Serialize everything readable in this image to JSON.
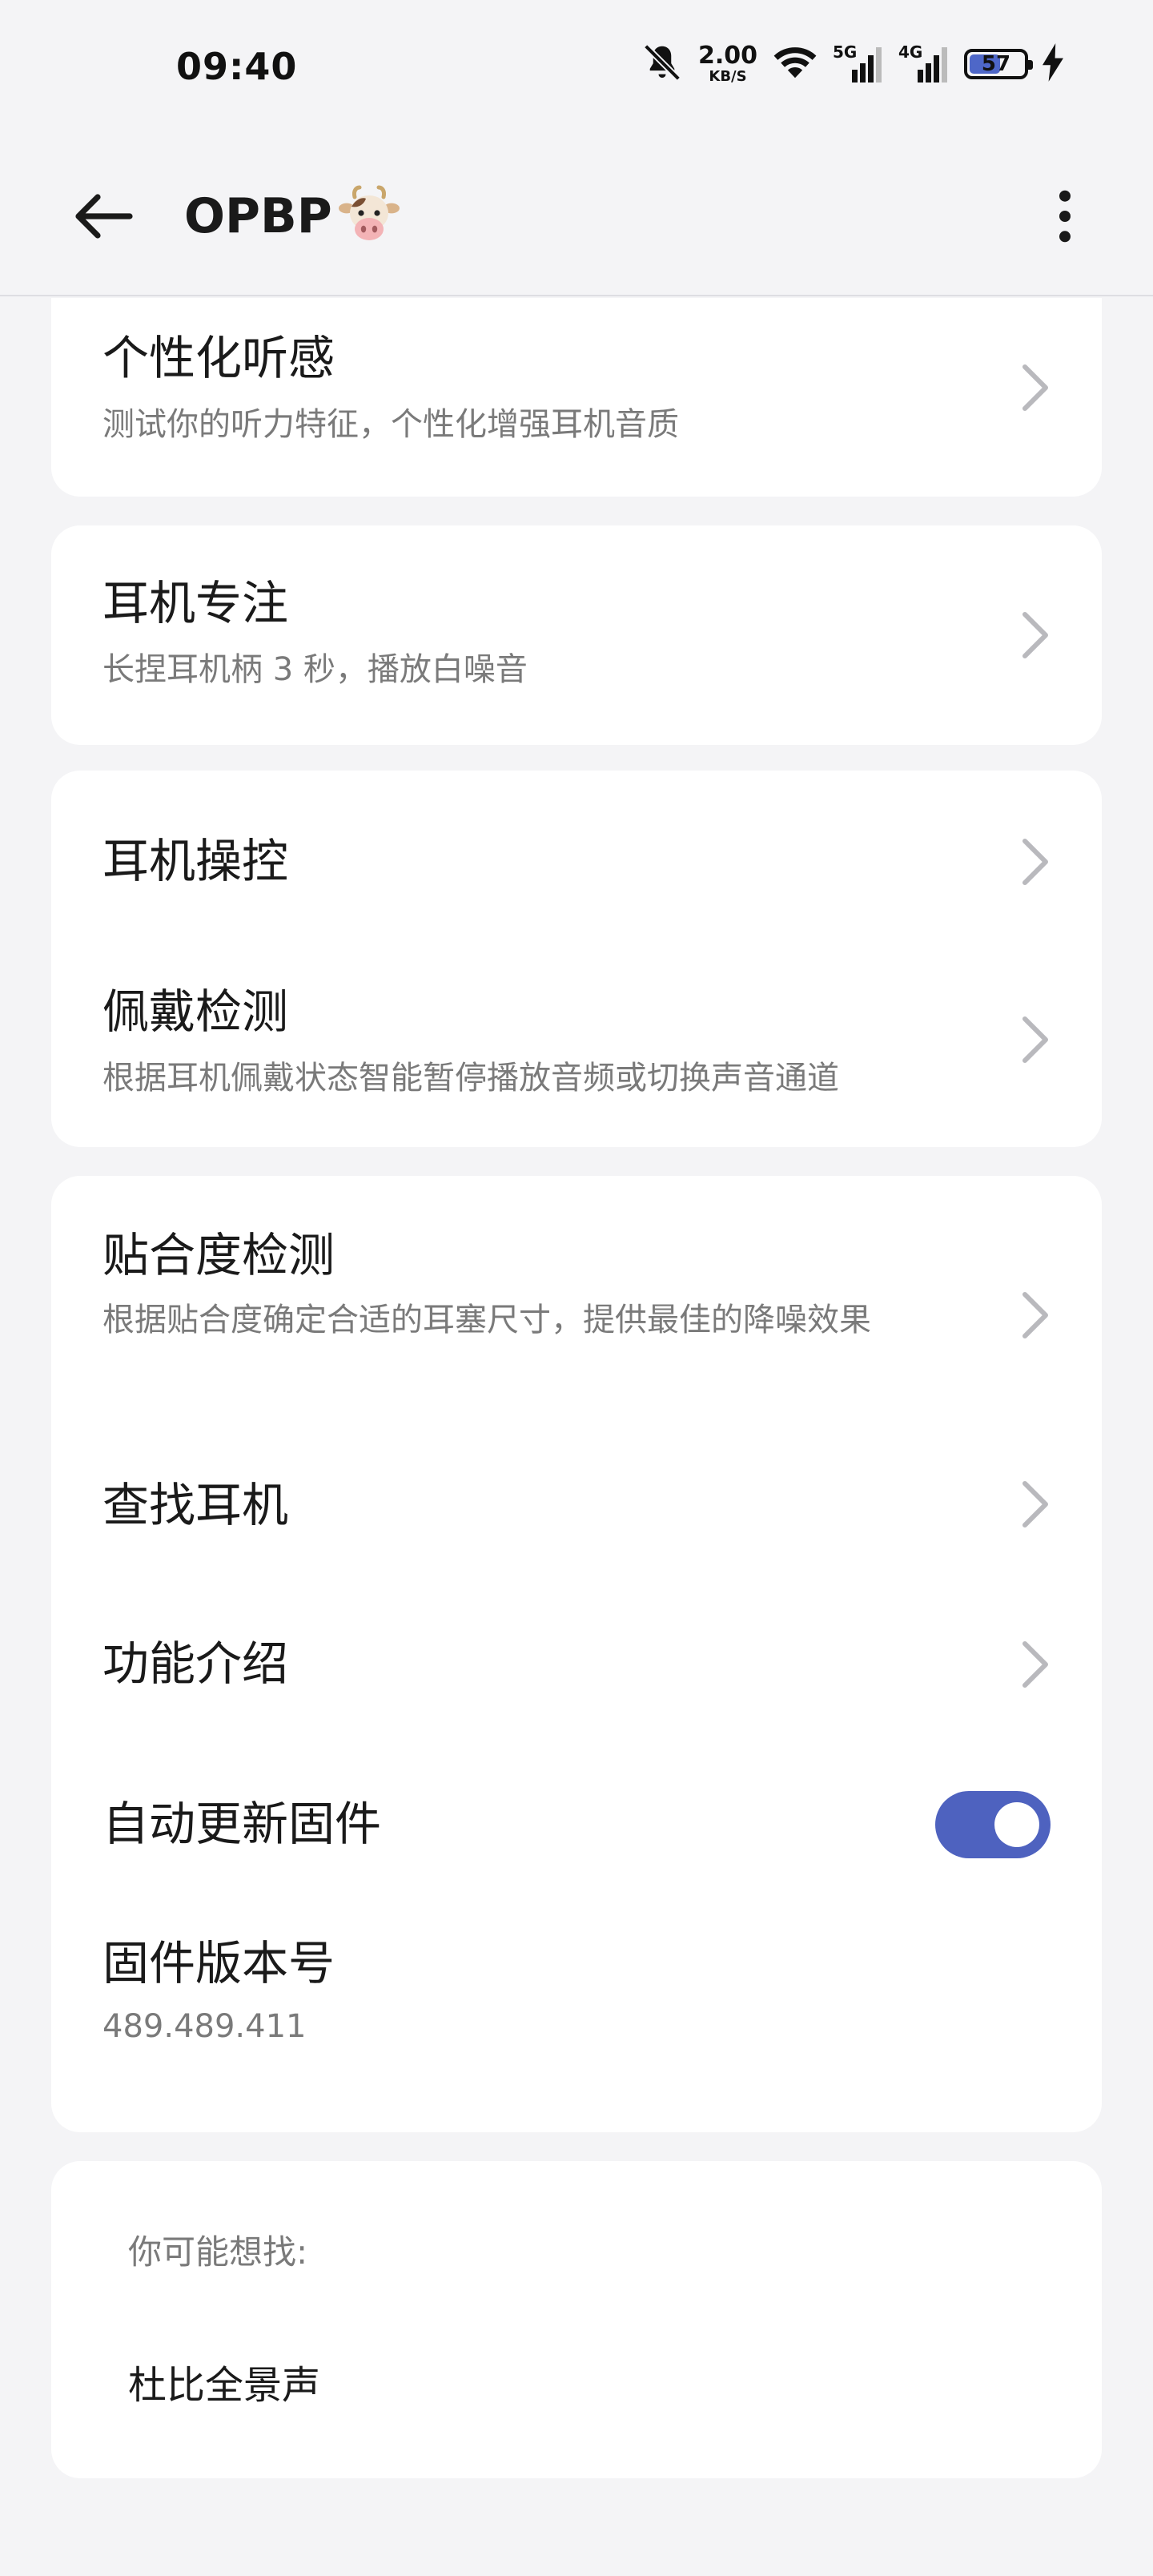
{
  "status_bar": {
    "time": "09:40",
    "net_speed_value": "2.00",
    "net_speed_unit": "KB/S",
    "sim1_label": "5G",
    "sim2_label": "4G",
    "battery_level": "57",
    "battery_fraction": 0.57,
    "accent_color": "#4e67c8"
  },
  "app_bar": {
    "title": "OPBP",
    "title_emoji": "cow-face-emoji"
  },
  "settings": {
    "personalized_sound": {
      "title": "个性化听感",
      "subtitle": "测试你的听力特征，个性化增强耳机音质"
    },
    "focus": {
      "title": "耳机专注",
      "subtitle": "长捏耳机柄 3 秒，播放白噪音"
    },
    "controls": {
      "title": "耳机操控"
    },
    "wear_detection": {
      "title": "佩戴检测",
      "subtitle": "根据耳机佩戴状态智能暂停播放音频或切换声音通道"
    },
    "fit_test": {
      "title": "贴合度检测",
      "subtitle": "根据贴合度确定合适的耳塞尺寸，提供最佳的降噪效果"
    },
    "find_earbuds": {
      "title": "查找耳机"
    },
    "features": {
      "title": "功能介绍"
    },
    "auto_update": {
      "title": "自动更新固件",
      "enabled": true,
      "toggle_color": "#4e62bf"
    },
    "firmware_version": {
      "title": "固件版本号",
      "value": "489.489.411"
    }
  },
  "suggestions": {
    "label": "你可能想找:",
    "items": [
      "杜比全景声"
    ]
  }
}
